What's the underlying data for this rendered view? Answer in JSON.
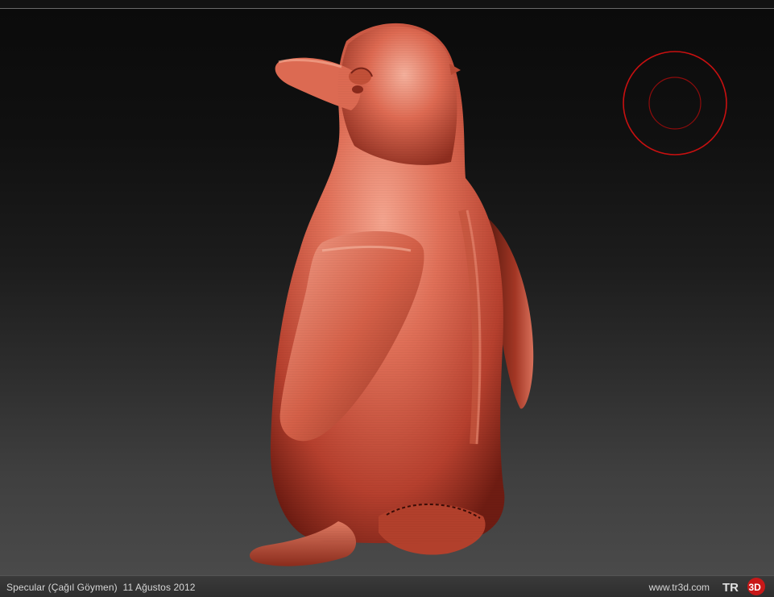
{
  "caption": {
    "text": "Specular (Çağıl Göymen)  11 Ağustos 2012"
  },
  "footer": {
    "site": "www.tr3d.com",
    "logo_text": "TR3D",
    "logo_prefix": "TR",
    "logo_suffix": "3D"
  },
  "viewport": {
    "model": "penguin-sculpt",
    "model_color": "#d85a48",
    "brush_cursor_color": "#c81010",
    "background_top": "#0b0b0b",
    "background_bottom": "#4a4a4a"
  }
}
